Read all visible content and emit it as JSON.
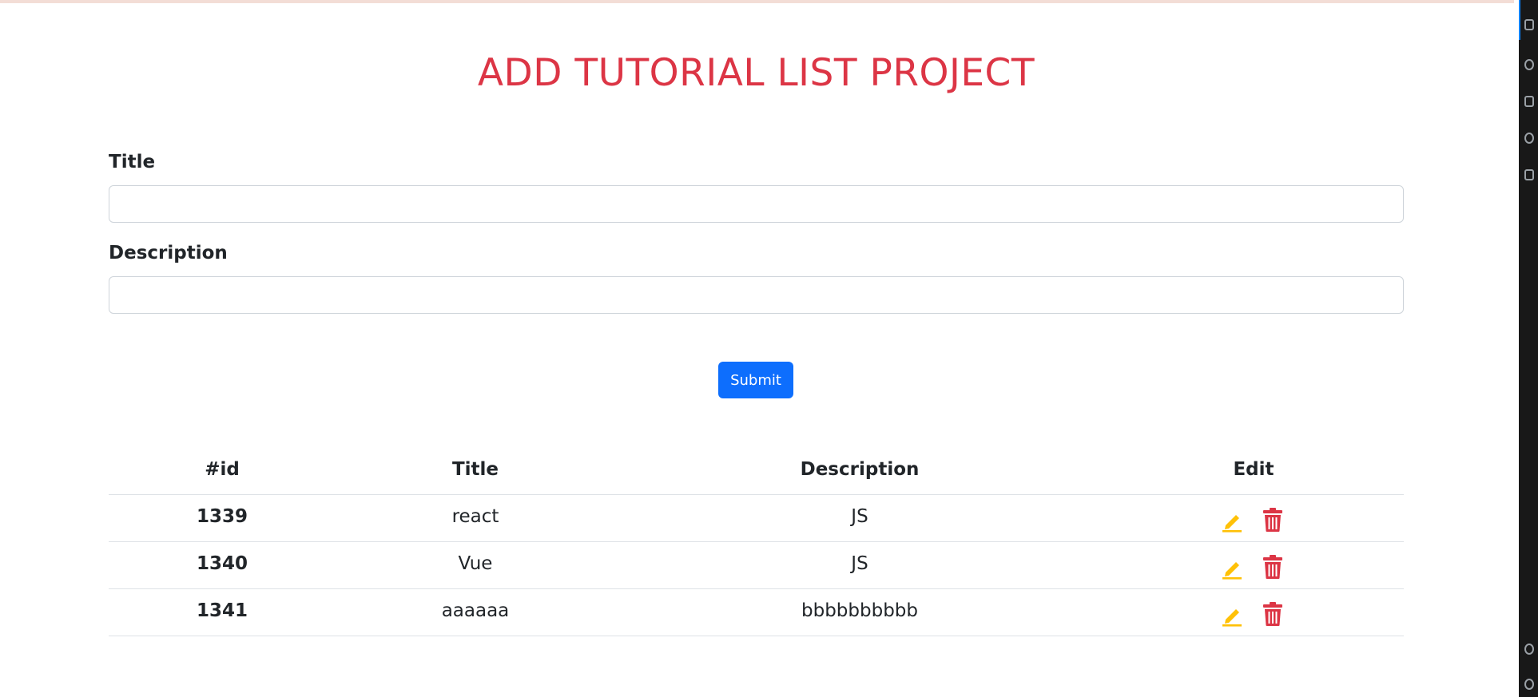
{
  "page": {
    "title": "ADD TUTORIAL LIST PROJECT"
  },
  "form": {
    "title_label": "Title",
    "title_value": "",
    "description_label": "Description",
    "description_value": "",
    "submit_label": "Submit"
  },
  "table": {
    "headers": {
      "id": "#id",
      "title": "Title",
      "description": "Description",
      "edit": "Edit"
    },
    "rows": [
      {
        "id": "1339",
        "title": "react",
        "description": "JS"
      },
      {
        "id": "1340",
        "title": "Vue",
        "description": "JS"
      },
      {
        "id": "1341",
        "title": "aaaaaa",
        "description": "bbbbbbbbbb"
      }
    ]
  },
  "icons": {
    "edit": "pencil-icon",
    "delete": "trash-icon"
  },
  "colors": {
    "title": "#dc3545",
    "primary": "#0d6efd",
    "edit_icon": "#ffc107",
    "delete_icon": "#dc3545"
  }
}
